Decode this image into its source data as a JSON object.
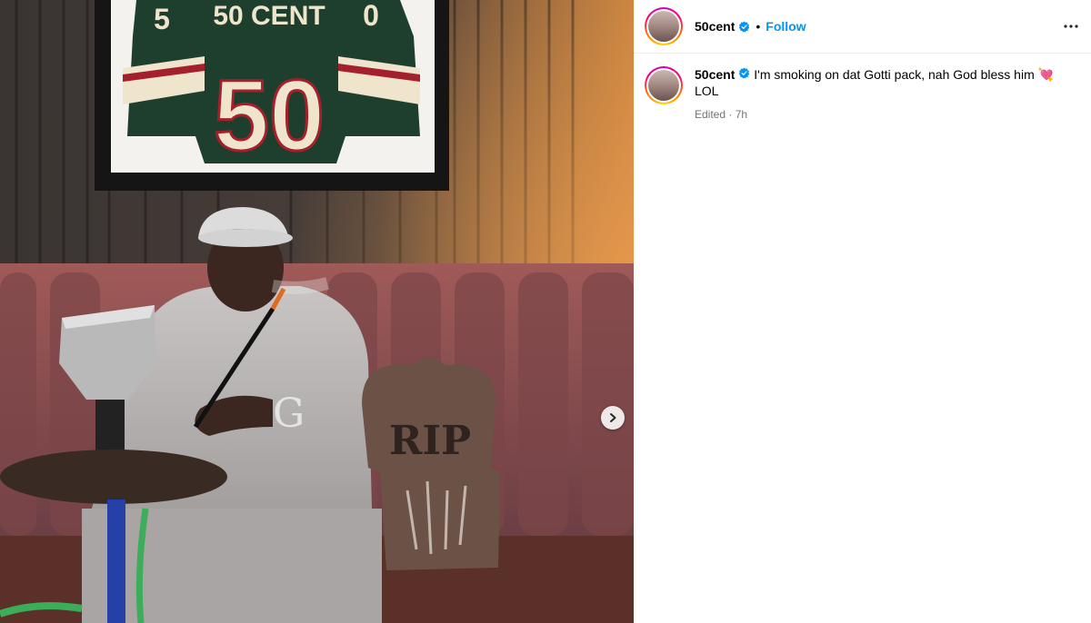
{
  "post": {
    "username": "50cent",
    "follow_label": "Follow",
    "separator": "•",
    "caption": "I'm smoking on dat Gotti pack, nah God bless him 💘 LOL",
    "edited_label": "Edited",
    "meta_separator": " · ",
    "time_ago": "7h"
  },
  "photo": {
    "jersey_name": "50 CENT",
    "jersey_number": "50",
    "sleeve_left": "5",
    "sleeve_right": "0",
    "tombstone_text": "RIP"
  },
  "icons": {
    "verified": "verified-badge-icon",
    "more": "more-options-icon",
    "next": "chevron-right-icon"
  },
  "colors": {
    "accent": "#0095f6",
    "verified": "#0095f6",
    "muted": "#737373"
  }
}
